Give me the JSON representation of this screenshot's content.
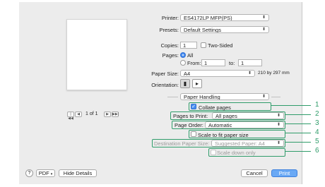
{
  "printer": {
    "label": "Printer:",
    "value": "ES4172LP MFP(PS)"
  },
  "presets": {
    "label": "Presets:",
    "value": "Default Settings"
  },
  "copies": {
    "label": "Copies:",
    "value": "1",
    "two_sided_label": "Two-Sided"
  },
  "pages": {
    "label": "Pages:",
    "all_label": "All",
    "from_label": "From:",
    "from_value": "1",
    "to_label": "to:",
    "to_value": "1"
  },
  "paper_size": {
    "label": "Paper Size:",
    "value": "A4",
    "dimensions": "210 by 297 mm"
  },
  "orientation": {
    "label": "Orientation:"
  },
  "section": {
    "value": "Paper Handling"
  },
  "collate": {
    "label": "Collate pages"
  },
  "pages_to_print": {
    "label": "Pages to Print:",
    "value": "All pages"
  },
  "page_order": {
    "label": "Page Order:",
    "value": "Automatic"
  },
  "scale_fit": {
    "label": "Scale to fit paper size"
  },
  "destination": {
    "label": "Destination Paper Size:",
    "value": "Suggested Paper: A4"
  },
  "scale_down": {
    "label": "Scale down only"
  },
  "navigator": {
    "page_text": "1 of 1"
  },
  "callouts": [
    "1",
    "2",
    "3",
    "4",
    "5",
    "6"
  ],
  "footer": {
    "help": "?",
    "pdf": "PDF",
    "hide_details": "Hide Details",
    "cancel": "Cancel",
    "print": "Print"
  },
  "colors": {
    "callout": "#2f9c6a",
    "accent": "#4a8ef0"
  }
}
